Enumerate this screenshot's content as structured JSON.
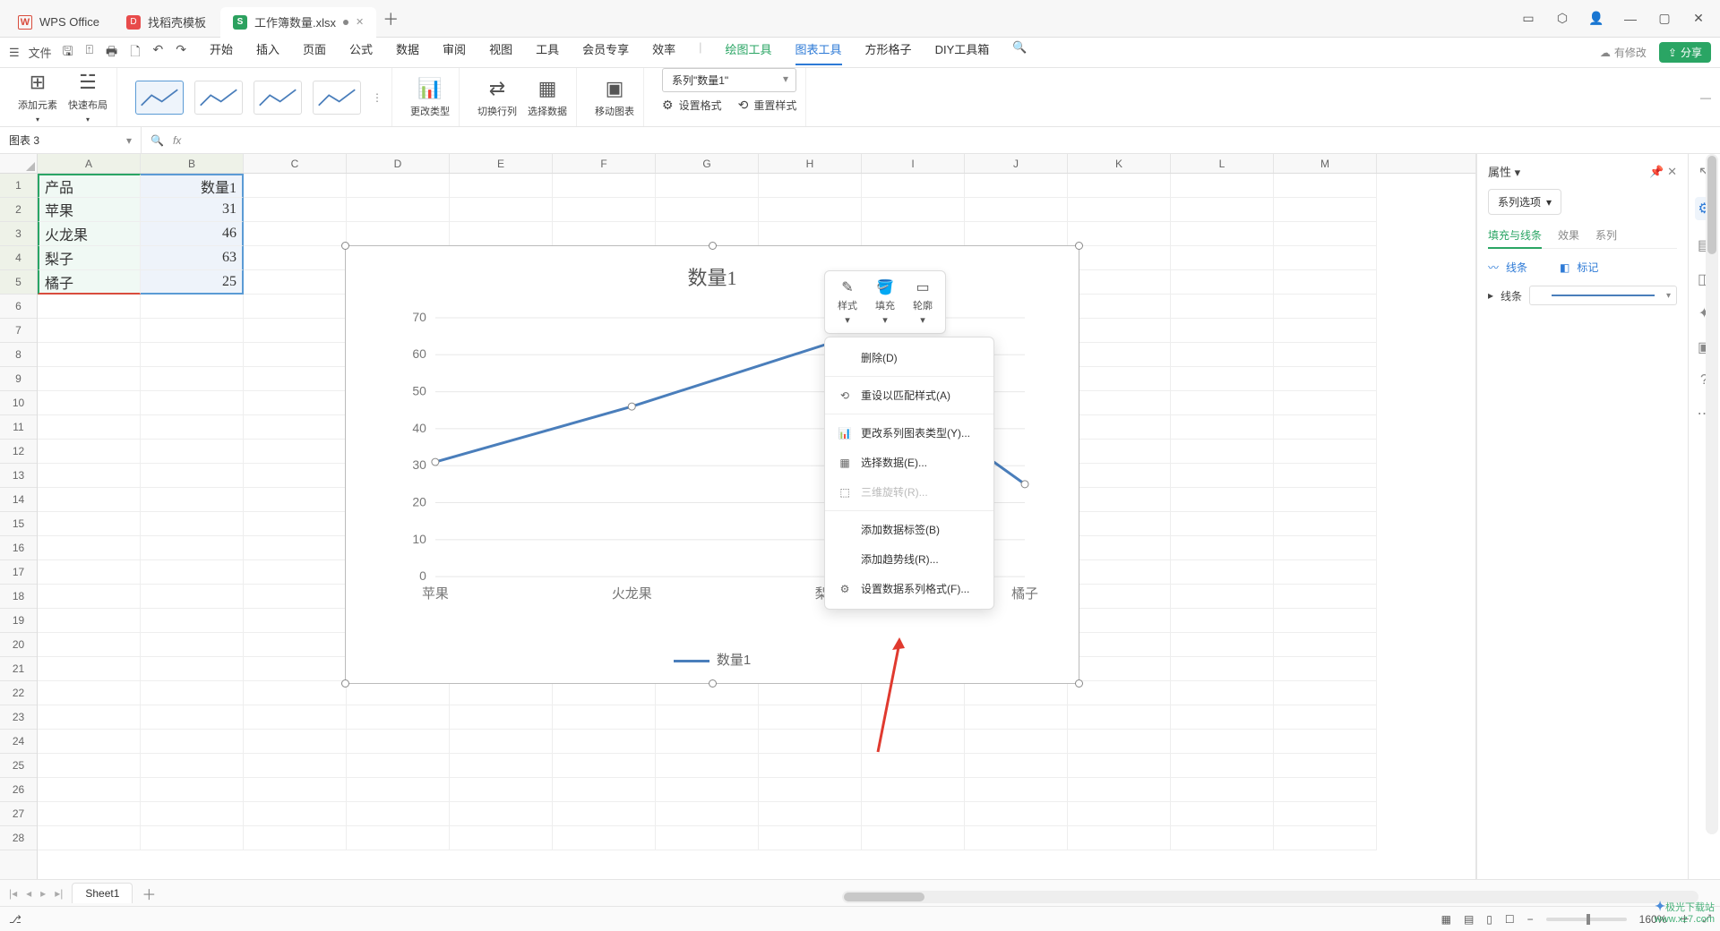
{
  "titlebar": {
    "tabs": [
      {
        "icon": "W",
        "label": "WPS Office"
      },
      {
        "icon": "D",
        "label": "找稻壳模板"
      },
      {
        "icon": "S",
        "label": "工作簿数量.xlsx",
        "active": true,
        "dirty": true
      }
    ]
  },
  "menu": {
    "file": "文件",
    "tabs": [
      "开始",
      "插入",
      "页面",
      "公式",
      "数据",
      "审阅",
      "视图",
      "工具",
      "会员专享",
      "效率"
    ],
    "tabs2": [
      "绘图工具",
      "图表工具",
      "方形格子",
      "DIY工具箱"
    ],
    "active": "图表工具",
    "green": "绘图工具",
    "cloud": "有修改",
    "share": "分享"
  },
  "ribbon": {
    "add_element": "添加元素",
    "quick_layout": "快速布局",
    "change_type": "更改类型",
    "switch_rc": "切换行列",
    "select_data": "选择数据",
    "move_chart": "移动图表",
    "series_select": "系列\"数量1\"",
    "set_format": "设置格式",
    "reset_style": "重置样式"
  },
  "namebox": "图表 3",
  "grid": {
    "cols": [
      "A",
      "B",
      "C",
      "D",
      "E",
      "F",
      "G",
      "H",
      "I",
      "J",
      "K",
      "L",
      "M"
    ],
    "rows": 28,
    "data": [
      [
        "产品",
        "数量1"
      ],
      [
        "苹果",
        "31"
      ],
      [
        "火龙果",
        "46"
      ],
      [
        "梨子",
        "63"
      ],
      [
        "橘子",
        "25"
      ]
    ]
  },
  "chart_data": {
    "type": "line",
    "title": "数量1",
    "categories": [
      "苹果",
      "火龙果",
      "梨子",
      "橘子"
    ],
    "series": [
      {
        "name": "数量1",
        "values": [
          31,
          46,
          63,
          25
        ],
        "color": "#4a7ebb"
      }
    ],
    "ylim": [
      0,
      70
    ],
    "yticks": [
      0,
      10,
      20,
      30,
      40,
      50,
      60,
      70
    ],
    "legend": "数量1"
  },
  "minitoolbar": {
    "style": "样式",
    "fill": "填充",
    "outline": "轮廓"
  },
  "context_menu": [
    {
      "label": "删除(D)"
    },
    {
      "sep": true
    },
    {
      "icon": "⟲",
      "label": "重设以匹配样式(A)"
    },
    {
      "sep": true
    },
    {
      "icon": "📊",
      "label": "更改系列图表类型(Y)..."
    },
    {
      "icon": "▦",
      "label": "选择数据(E)..."
    },
    {
      "icon": "⬚",
      "label": "三维旋转(R)...",
      "disabled": true
    },
    {
      "sep": true
    },
    {
      "label": "添加数据标签(B)"
    },
    {
      "label": "添加趋势线(R)..."
    },
    {
      "icon": "⚙",
      "label": "设置数据系列格式(F)..."
    }
  ],
  "rightpane": {
    "title": "属性",
    "dropdown": "系列选项",
    "tabs": [
      "填充与线条",
      "效果",
      "系列"
    ],
    "active": "填充与线条",
    "linklinks": [
      "线条",
      "标记"
    ],
    "line_label": "线条"
  },
  "sheet_tab": "Sheet1",
  "status": {
    "zoom": "160%"
  },
  "watermark": {
    "brand": "极光下载站",
    "url": "www.xz7.com"
  }
}
